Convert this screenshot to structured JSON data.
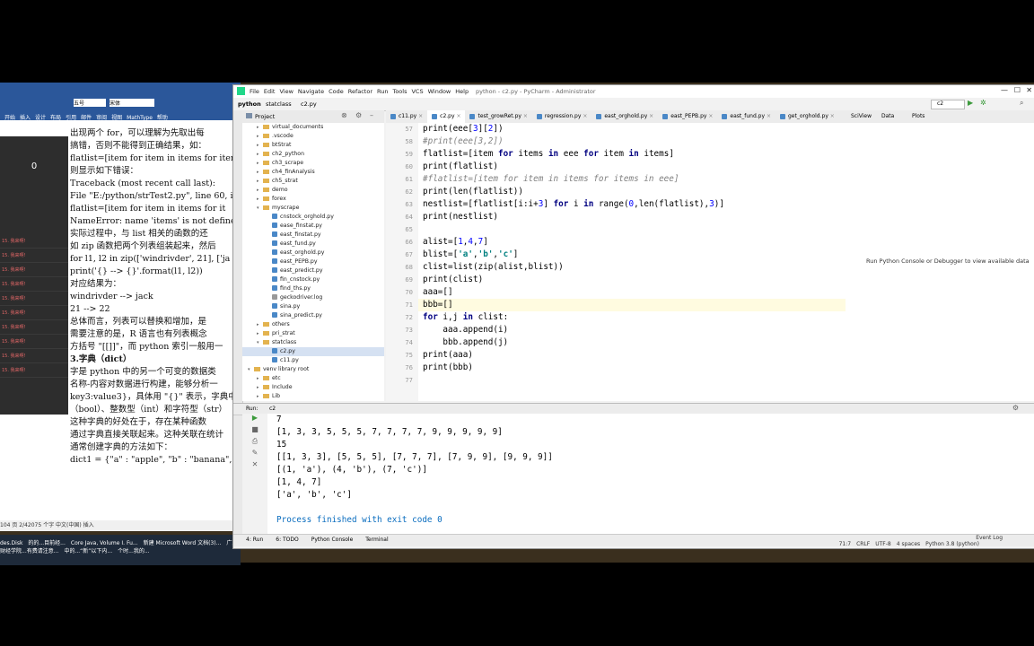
{
  "word": {
    "tabs": [
      "开始",
      "插入",
      "设计",
      "布局",
      "引用",
      "邮件",
      "审阅",
      "视图",
      "MathType",
      "帮助"
    ],
    "font_name": "宋体",
    "font_size": "五号",
    "sidebar_count": "0",
    "sidebar_items": [
      "15. 我来啊!",
      "15. 我来啊!",
      "15. 我来啊!",
      "15. 我来啊!",
      "15. 我来啊!",
      "15. 我来啊!",
      "15. 我来啊!",
      "15. 我来啊!",
      "15. 我来啊!",
      "15. 我来啊!"
    ],
    "body_lines": [
      "出现两个 for，可以理解为先取出每",
      "搞错，否则不能得到正确结果，如：",
      "flatlist=[item for item in items for item",
      "则显示如下错误：",
      "Traceback (most recent call last):",
      "  File \"E:/python/strTest2.py\", line 60, i",
      "    flatlist=[item for item in items for it",
      "NameError: name 'items' is not defined",
      "实际过程中，与 list 相关的函数的还",
      "如 zip 函数把两个列表组装起来，然后",
      "for l1, l2 in zip(['windrivder', 21], ['ja",
      "    print('{} --> {}'.format(l1, l2))",
      "对应结果为：",
      "windrivder --> jack",
      "21 --> 22",
      "总体而言，列表可以替换和增加，是",
      "需要注意的是，R 语言也有列表概念",
      "方括号 \"[[]]\"，而 python 索引一般用一",
      "",
      "3.字典（dict）",
      "字是 python 中的另一个可变的数据类",
      "名称-内容对数据进行构建，能够分析一",
      "key3:value3}，具体用 \"{}\" 表示，字典中",
      "（bool）、整数型（int）和字符型（str）",
      "这种字典的好处在于，存在某种函数",
      "通过字典直接关联起来。这种关联在统计",
      "通常创建字典的方法如下：",
      "dict1 = {\"a\" : \"apple\", \"b\" : \"banana\","
    ],
    "status": "104 页   2/42075 个字   中文(中国)   插入"
  },
  "taskbar": {
    "items": [
      "des.Disk",
      "的的...目前经...",
      "Core Java, Volume I. Fu...",
      "新建 Microsoft Word 文档(3)...",
      "广东财经学院...有费请注意...",
      "中的...“新”以下内...",
      "个时...我的..."
    ]
  },
  "pycharm": {
    "title": "python - c2.py - PyCharm - Administrator",
    "menu": [
      "File",
      "Edit",
      "View",
      "Navigate",
      "Code",
      "Refactor",
      "Run",
      "Tools",
      "VCS",
      "Window",
      "Help"
    ],
    "breadcrumb": [
      "python",
      "statclass",
      "c2.py"
    ],
    "run_config": "c2",
    "project_label": "Project",
    "tree": [
      {
        "name": "virtual_documents",
        "type": "folder",
        "indent": 1
      },
      {
        "name": ".vscode",
        "type": "folder",
        "indent": 1
      },
      {
        "name": "btStrat",
        "type": "folder",
        "indent": 1
      },
      {
        "name": "ch2_python",
        "type": "folder",
        "indent": 1
      },
      {
        "name": "ch3_scrape",
        "type": "folder",
        "indent": 1
      },
      {
        "name": "ch4_finAnalysis",
        "type": "folder",
        "indent": 1
      },
      {
        "name": "ch5_strat",
        "type": "folder",
        "indent": 1
      },
      {
        "name": "demo",
        "type": "folder",
        "indent": 1
      },
      {
        "name": "forex",
        "type": "folder",
        "indent": 1
      },
      {
        "name": "myscrape",
        "type": "folder-open",
        "indent": 1
      },
      {
        "name": "cnstock_orghold.py",
        "type": "py",
        "indent": 2
      },
      {
        "name": "ease_finstat.py",
        "type": "py",
        "indent": 2
      },
      {
        "name": "east_finstat.py",
        "type": "py",
        "indent": 2
      },
      {
        "name": "east_fund.py",
        "type": "py",
        "indent": 2
      },
      {
        "name": "east_orghold.py",
        "type": "py",
        "indent": 2
      },
      {
        "name": "east_PEPB.py",
        "type": "py",
        "indent": 2
      },
      {
        "name": "east_predict.py",
        "type": "py",
        "indent": 2
      },
      {
        "name": "fin_cnstock.py",
        "type": "py",
        "indent": 2
      },
      {
        "name": "find_ths.py",
        "type": "py",
        "indent": 2
      },
      {
        "name": "geckodriver.log",
        "type": "file",
        "indent": 2
      },
      {
        "name": "sina.py",
        "type": "py",
        "indent": 2
      },
      {
        "name": "sina_predict.py",
        "type": "py",
        "indent": 2
      },
      {
        "name": "others",
        "type": "folder",
        "indent": 1
      },
      {
        "name": "pri_strat",
        "type": "folder",
        "indent": 1
      },
      {
        "name": "statclass",
        "type": "folder-open",
        "indent": 1
      },
      {
        "name": "c2.py",
        "type": "py",
        "indent": 2,
        "selected": true
      },
      {
        "name": "c11.py",
        "type": "py",
        "indent": 2
      },
      {
        "name": "venv  library root",
        "type": "folder-open",
        "indent": 0
      },
      {
        "name": "etc",
        "type": "folder",
        "indent": 1
      },
      {
        "name": "Include",
        "type": "folder",
        "indent": 1
      },
      {
        "name": "Lib",
        "type": "folder",
        "indent": 1
      }
    ],
    "tabs": [
      "c11.py",
      "c2.py",
      "test_growRet.py",
      "regression.py",
      "east_orghold.py",
      "east_PEPB.py",
      "east_fund.py",
      "get_orghold.py"
    ],
    "active_tab": 1,
    "line_numbers": [
      "57",
      "58",
      "59",
      "60",
      "61",
      "62",
      "63",
      "64",
      "65",
      "66",
      "67",
      "68",
      "69",
      "70",
      "71",
      "72",
      "73",
      "74",
      "75",
      "76",
      "77"
    ],
    "code": [
      [
        {
          "t": "print(eee[",
          "c": ""
        },
        {
          "t": "3",
          "c": "num"
        },
        {
          "t": "][",
          "c": ""
        },
        {
          "t": "2",
          "c": "num"
        },
        {
          "t": "])",
          "c": ""
        }
      ],
      [
        {
          "t": "#print(eee[3,2])",
          "c": "cm"
        }
      ],
      [
        {
          "t": "flatlist=[item ",
          "c": ""
        },
        {
          "t": "for",
          "c": "kw"
        },
        {
          "t": " items ",
          "c": ""
        },
        {
          "t": "in",
          "c": "kw"
        },
        {
          "t": " eee ",
          "c": ""
        },
        {
          "t": "for",
          "c": "kw"
        },
        {
          "t": " item ",
          "c": ""
        },
        {
          "t": "in",
          "c": "kw"
        },
        {
          "t": " items]",
          "c": ""
        }
      ],
      [
        {
          "t": "print(flatlist)",
          "c": ""
        }
      ],
      [
        {
          "t": "#flatlist=[item for item in items for items in eee]",
          "c": "cm"
        }
      ],
      [
        {
          "t": "print(len(flatlist))",
          "c": ""
        }
      ],
      [
        {
          "t": "nestlist=[flatlist[i:i+",
          "c": ""
        },
        {
          "t": "3",
          "c": "num"
        },
        {
          "t": "] ",
          "c": ""
        },
        {
          "t": "for",
          "c": "kw"
        },
        {
          "t": " i ",
          "c": ""
        },
        {
          "t": "in",
          "c": "kw"
        },
        {
          "t": " range(",
          "c": ""
        },
        {
          "t": "0",
          "c": "num"
        },
        {
          "t": ",len(flatlist),",
          "c": ""
        },
        {
          "t": "3",
          "c": "num"
        },
        {
          "t": ")]",
          "c": ""
        }
      ],
      [
        {
          "t": "print(nestlist)",
          "c": ""
        }
      ],
      [
        {
          "t": "",
          "c": ""
        }
      ],
      [
        {
          "t": "alist=[",
          "c": ""
        },
        {
          "t": "1",
          "c": "num"
        },
        {
          "t": ",",
          "c": ""
        },
        {
          "t": "4",
          "c": "num"
        },
        {
          "t": ",",
          "c": ""
        },
        {
          "t": "7",
          "c": "num"
        },
        {
          "t": "]",
          "c": ""
        }
      ],
      [
        {
          "t": "blist=[",
          "c": ""
        },
        {
          "t": "'a'",
          "c": "str"
        },
        {
          "t": ",",
          "c": ""
        },
        {
          "t": "'b'",
          "c": "str"
        },
        {
          "t": ",",
          "c": ""
        },
        {
          "t": "'c'",
          "c": "str"
        },
        {
          "t": "]",
          "c": ""
        }
      ],
      [
        {
          "t": "clist=list(zip(alist,blist))",
          "c": ""
        }
      ],
      [
        {
          "t": "print(clist)",
          "c": ""
        }
      ],
      [
        {
          "t": "aaa=[]",
          "c": ""
        }
      ],
      [
        {
          "t": "bbb=[]",
          "c": ""
        }
      ],
      [
        {
          "t": "for",
          "c": "kw"
        },
        {
          "t": " i,j ",
          "c": ""
        },
        {
          "t": "in",
          "c": "kw"
        },
        {
          "t": " clist:",
          "c": ""
        }
      ],
      [
        {
          "t": "    aaa.append(i)",
          "c": ""
        }
      ],
      [
        {
          "t": "    bbb.append(j)",
          "c": ""
        }
      ],
      [
        {
          "t": "print(aaa)",
          "c": ""
        }
      ],
      [
        {
          "t": "print(bbb)",
          "c": ""
        }
      ],
      [
        {
          "t": "",
          "c": ""
        }
      ]
    ],
    "current_line_index": 14,
    "sci_tabs": [
      "SciView",
      "Data",
      "Plots"
    ],
    "sci_message": "Run Python Console or Debugger to view available data",
    "run_label": "Run:",
    "run_tab": "c2",
    "console": [
      "7",
      "[1, 3, 3, 5, 5, 5, 7, 7, 7, 7, 9, 9, 9, 9, 9]",
      "15",
      "[[1, 3, 3], [5, 5, 5], [7, 7, 7], [7, 9, 9], [9, 9, 9]]",
      "[(1, 'a'), (4, 'b'), (7, 'c')]",
      "[1, 4, 7]",
      "['a', 'b', 'c']",
      "",
      "Process finished with exit code 0"
    ],
    "bottom_tabs": [
      "4: Run",
      "6: TODO",
      "Python Console",
      "Terminal"
    ],
    "event_log": "Event Log",
    "status": {
      "position": "71:7",
      "line_sep": "CRLF",
      "encoding": "UTF-8",
      "indent": "4 spaces",
      "interpreter": "Python 3.8 (python)"
    }
  }
}
